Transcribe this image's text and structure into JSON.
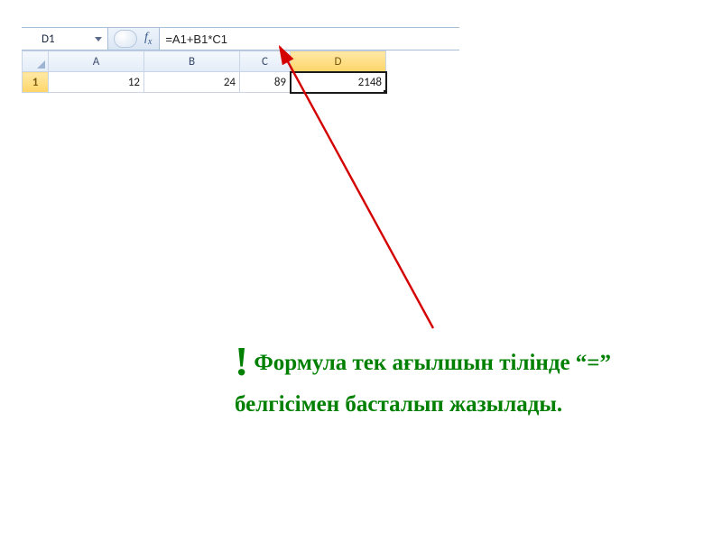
{
  "formula_bar": {
    "name_box": "D1",
    "fx_label": "fx",
    "formula": "=A1+B1*C1"
  },
  "columns": [
    "A",
    "B",
    "C",
    "D"
  ],
  "row_headers": [
    "1"
  ],
  "cells": {
    "A1": "12",
    "B1": "24",
    "C1": "89",
    "D1": "2148"
  },
  "selected_cell": "D1",
  "note": {
    "bang": "!",
    "text": "Формула тек ағылшын тілінде “=” белгісімен басталып  жазылады."
  }
}
